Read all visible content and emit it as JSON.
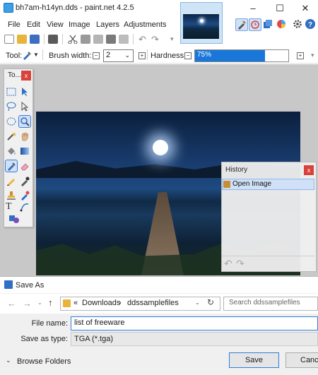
{
  "window": {
    "title": "bh7am-h14yn.dds - paint.net 4.2.5",
    "minimize": "–",
    "maximize": "☐",
    "close": "✕"
  },
  "menu": {
    "items": [
      "File",
      "Edit",
      "View",
      "Image",
      "Layers",
      "Adjustments"
    ]
  },
  "tool_options": {
    "tool_label": "Tool:",
    "brush_width_label": "Brush width:",
    "brush_width_value": "2",
    "hardness_label": "Hardness:",
    "hardness_value": "75%",
    "hardness_fraction": 0.75
  },
  "tools_window": {
    "title": "To...",
    "close": "x"
  },
  "history_window": {
    "title": "History",
    "close": "x",
    "items": [
      {
        "label": "Open Image",
        "icon": "open-image-icon"
      }
    ]
  },
  "save_dialog": {
    "title": "Save As",
    "breadcrumb": {
      "prefix": "«",
      "items": [
        "Downloads",
        "ddssamplefiles"
      ],
      "separator": "›"
    },
    "search_placeholder": "Search ddssamplefiles",
    "file_name_label": "File name:",
    "file_name_value": "list of freeware",
    "save_type_label": "Save as type:",
    "save_type_value": "TGA (*.tga)",
    "browse_folders_label": "Browse Folders",
    "save_button": "Save",
    "cancel_button": "Cancel"
  },
  "colors": {
    "accent": "#1877d8",
    "close_red": "#d9413b"
  }
}
